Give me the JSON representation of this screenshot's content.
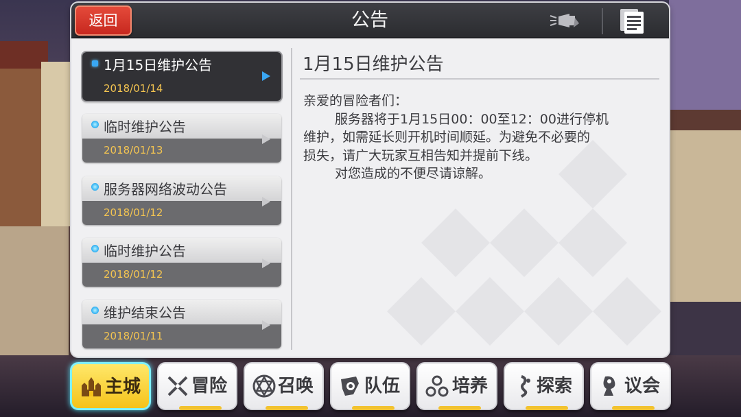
{
  "header": {
    "back_label": "返回",
    "title": "公告"
  },
  "announcements": [
    {
      "title": "1月15日维护公告",
      "date": "2018/01/14",
      "selected": true
    },
    {
      "title": "临时维护公告",
      "date": "2018/01/13",
      "selected": false
    },
    {
      "title": "服务器网络波动公告",
      "date": "2018/01/12",
      "selected": false
    },
    {
      "title": "临时维护公告",
      "date": "2018/01/12",
      "selected": false
    },
    {
      "title": "维护结束公告",
      "date": "2018/01/11",
      "selected": false
    }
  ],
  "detail": {
    "title": "1月15日维护公告",
    "greeting": "亲爱的冒险者们：",
    "line1": "服务器将于1月15日00：00至12：00进行停机",
    "line2": "维护，如需延长则开机时间顺延。为避免不必要的",
    "line3": "损失，请广大玩家互相告知并提前下线。",
    "line4": "对您造成的不便尽请谅解。"
  },
  "bottom_nav": [
    {
      "label": "主城",
      "icon": "castle-icon",
      "active": true
    },
    {
      "label": "冒险",
      "icon": "crossed-swords-icon",
      "active": false
    },
    {
      "label": "召唤",
      "icon": "summon-circle-icon",
      "active": false
    },
    {
      "label": "队伍",
      "icon": "team-icon",
      "active": false
    },
    {
      "label": "培养",
      "icon": "nurture-icon",
      "active": false
    },
    {
      "label": "探索",
      "icon": "explore-icon",
      "active": false
    },
    {
      "label": "议会",
      "icon": "council-icon",
      "active": false
    }
  ],
  "colors": {
    "accent_blue": "#3aa6f2",
    "date_gold": "#f3c451",
    "back_red": "#d9342a",
    "active_nav_yellow": "#f5c21a"
  }
}
